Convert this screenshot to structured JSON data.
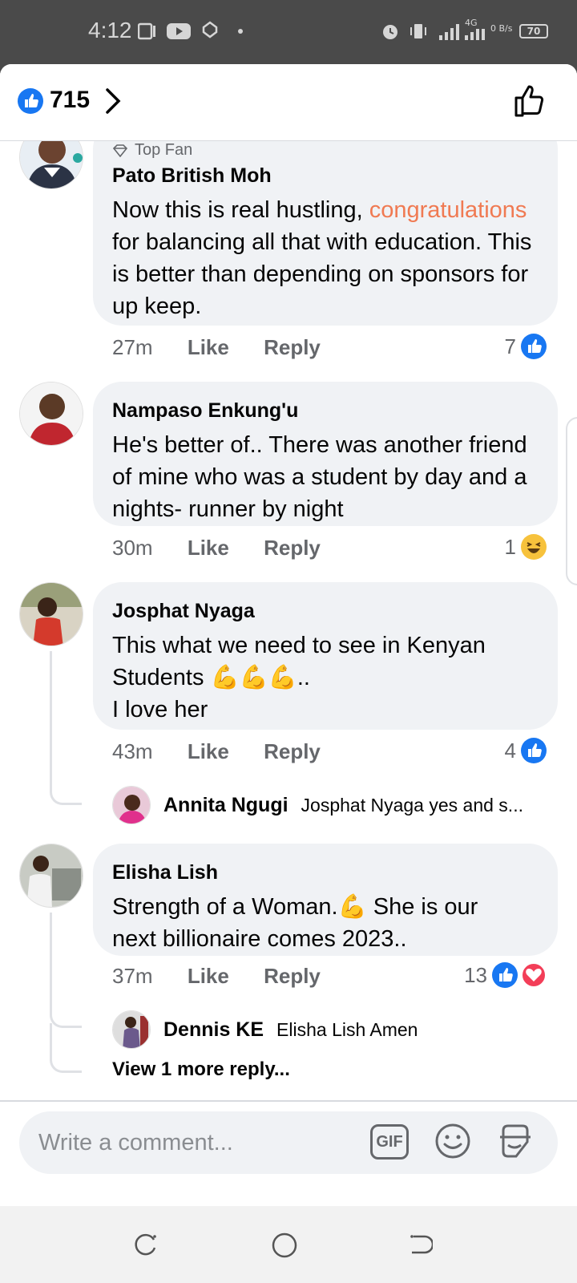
{
  "status_bar": {
    "time": "4:12",
    "network": "4G",
    "speed": "0 B/s",
    "battery": "70"
  },
  "header": {
    "reaction_count": "715"
  },
  "comments": [
    {
      "badge": "Top Fan",
      "author": "Pato British Moh",
      "text_before": "Now this is real hustling, ",
      "highlight": "congratulations",
      "text_after": " for balancing all that with education. This is better than depending on sponsors for up keep.",
      "time": "27m",
      "like_label": "Like",
      "reply_label": "Reply",
      "reaction_count": "7"
    },
    {
      "author": "Nampaso Enkung'u",
      "text": "He's better of.. There was another friend of mine who was a student by day and a nights- runner by night",
      "time": "30m",
      "like_label": "Like",
      "reply_label": "Reply",
      "reaction_count": "1"
    },
    {
      "author": "Josphat Nyaga",
      "text_line1": "This what we need to see in Kenyan",
      "text_line2": "Students 💪💪💪..",
      "text_line3": "I love her",
      "time": "43m",
      "like_label": "Like",
      "reply_label": "Reply",
      "reaction_count": "4",
      "reply": {
        "author": "Annita Ngugi",
        "text": "Josphat Nyaga yes and s..."
      }
    },
    {
      "author": "Elisha Lish",
      "text_line1": "Strength of a Woman.💪 She is our",
      "text_line2": "next  billionaire comes 2023..",
      "time": "37m",
      "like_label": "Like",
      "reply_label": "Reply",
      "reaction_count": "13",
      "reply": {
        "author": "Dennis KE",
        "text": "Elisha Lish Amen"
      },
      "view_more": "View 1 more reply..."
    }
  ],
  "composer": {
    "placeholder": "Write a comment...",
    "gif_label": "GIF"
  },
  "colors": {
    "accent": "#1877f2",
    "highlight": "#f07a52",
    "love": "#f33e58",
    "bubble": "#f0f2f5"
  }
}
